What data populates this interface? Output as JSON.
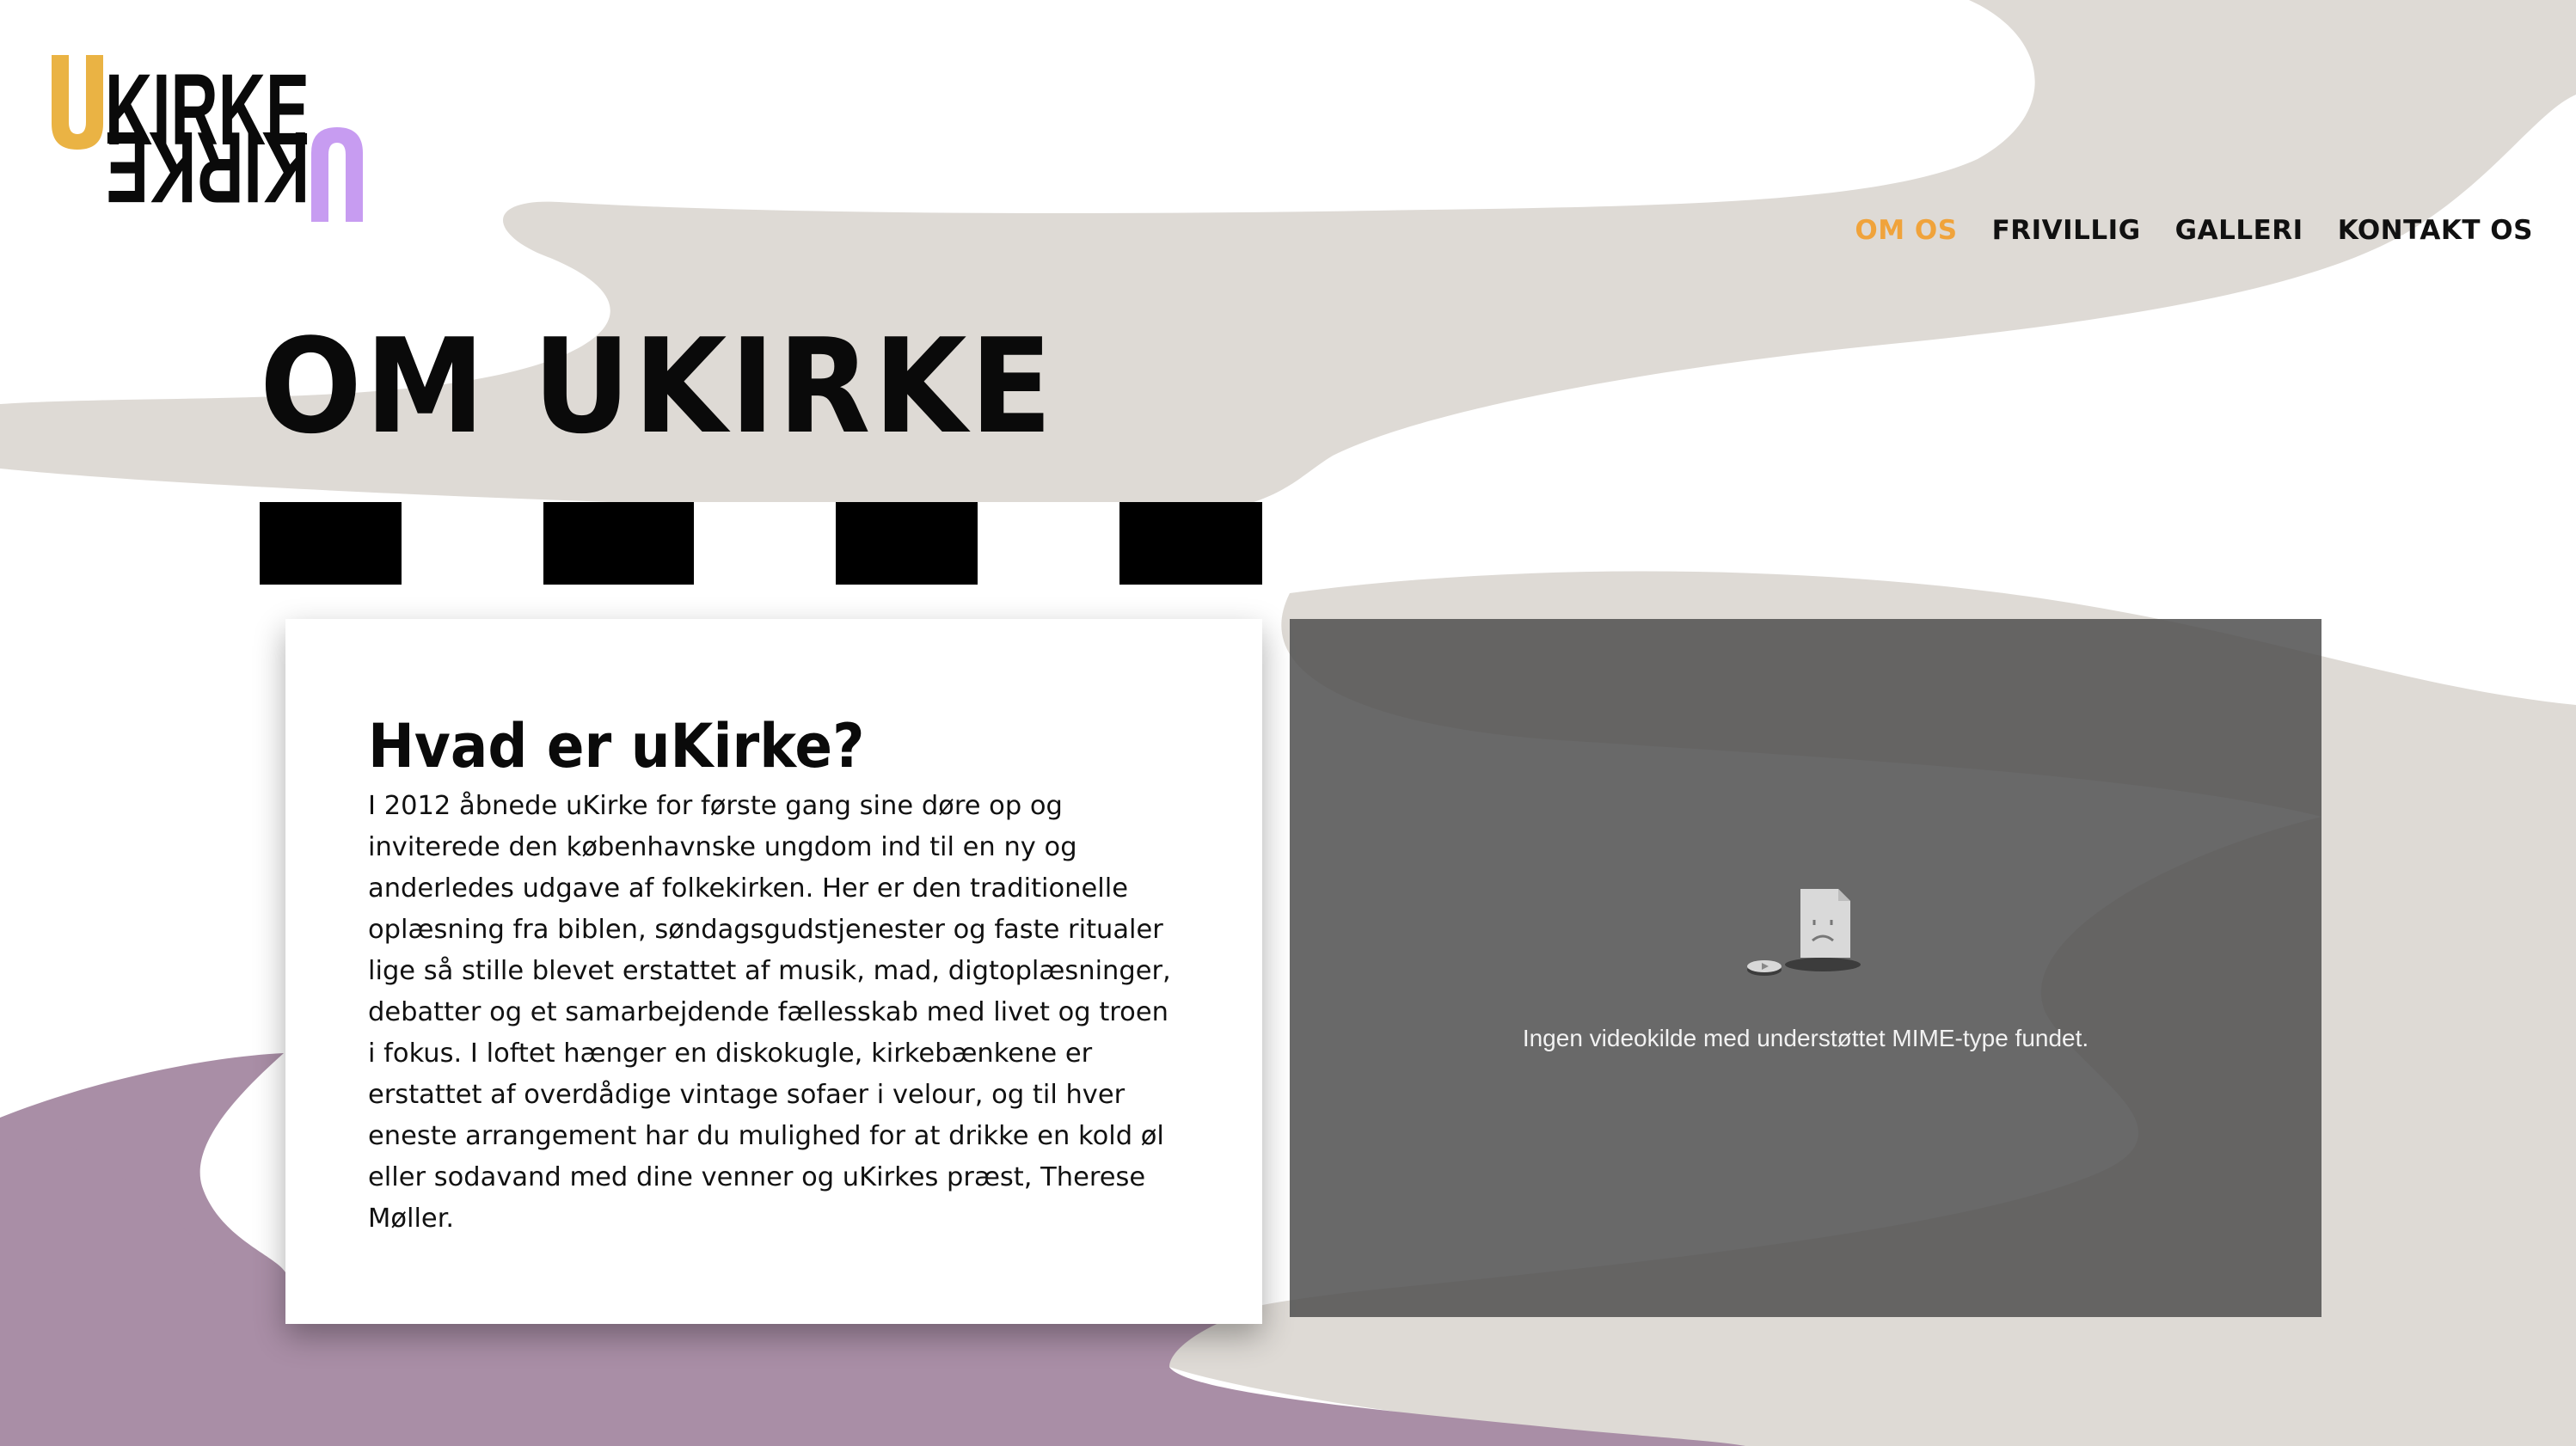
{
  "logo": {
    "top": "KIRKE",
    "bottom": "KIRKE",
    "mark": "U",
    "colors": {
      "top_u": "#eab344",
      "bottom_u": "#c79cf1",
      "text": "#0a0a0a"
    }
  },
  "nav": {
    "items": [
      {
        "label": "OM OS",
        "active": true
      },
      {
        "label": "FRIVILLIG",
        "active": false
      },
      {
        "label": "GALLERI",
        "active": false
      },
      {
        "label": "KONTAKT OS",
        "active": false
      }
    ],
    "active_color": "#f0a33b"
  },
  "page": {
    "title": "OM UKIRKE"
  },
  "card": {
    "heading": "Hvad er uKirke?",
    "body": "I 2012 åbnede uKirke for første gang sine døre op og inviterede den københavnske ungdom ind til en ny og anderledes udgave af folkekirken. Her er den traditionelle oplæsning fra biblen, søndagsgudstjenester og faste ritualer lige så stille blevet erstattet af musik, mad, digtoplæsninger, debatter og et samarbejdende fællesskab med livet og troen i fokus. I loftet hænger en diskokugle, kirkebænkene er erstattet af overdådige vintage sofaer i velour, og til hver eneste arrangement har du mulighed for at drikke en kold øl eller sodavand med dine venner og uKirkes præst, Therese Møller."
  },
  "video": {
    "error_message": "Ingen videokilde med understøttet MIME-type fundet.",
    "icon": "broken-video-icon"
  },
  "theme": {
    "beige": "#dedad5",
    "purple": "#a98ea6",
    "overlay": "#505050"
  }
}
